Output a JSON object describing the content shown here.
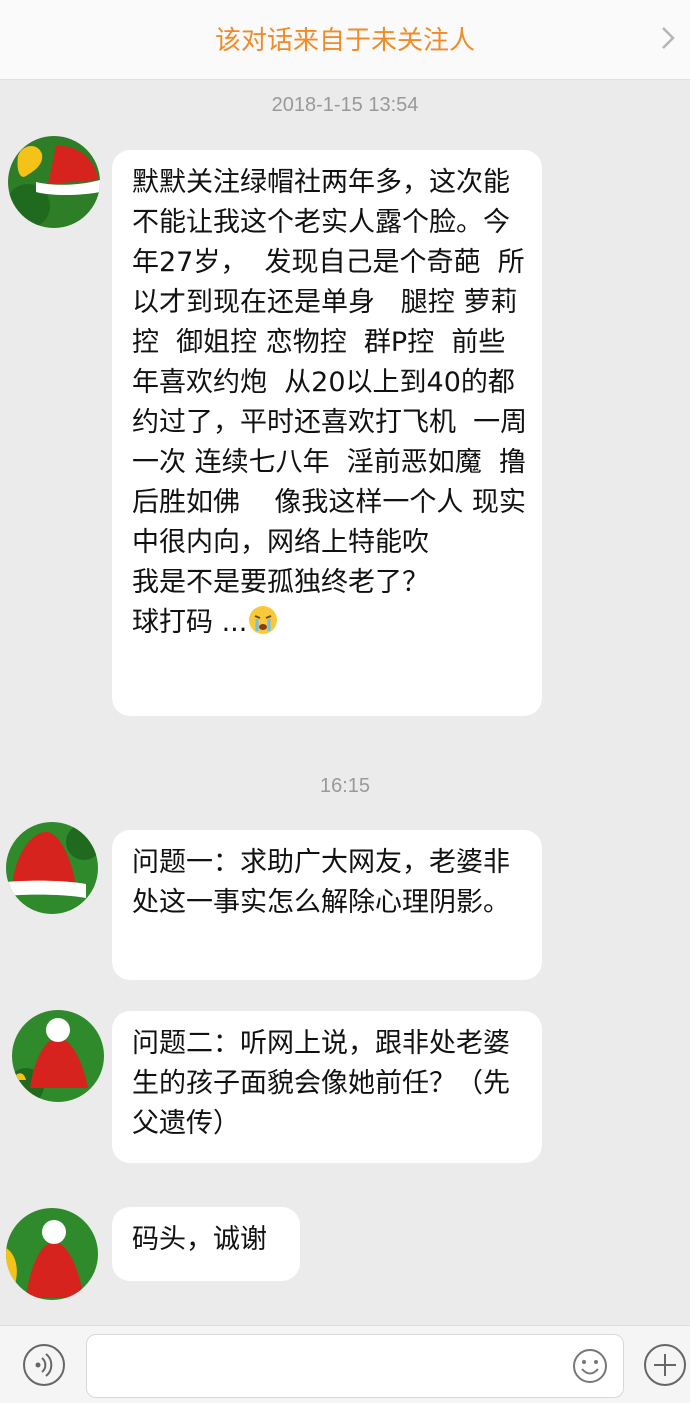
{
  "header": {
    "title": "该对话来自于未关注人"
  },
  "messages": [
    {
      "timestamp": "2018-1-15 13:54",
      "text": "默默关注绿帽社两年多，这次能不能让我这个老实人露个脸。今年27岁，  发现自己是个奇葩  所以才到现在还是单身   腿控 萝莉控  御姐控 恋物控  群P控  前些年喜欢约炮  从20以上到40的都约过了，平时还喜欢打飞机  一周一次 连续七八年  淫前恶如魔  撸后胜如佛    像我这样一个人 现实中很内向，网络上特能吹\n我是不是要孤独终老了？\n球打码 ..."
    },
    {
      "timestamp": "16:15",
      "text": "问题一：求助广大网友，老婆非处这一事实怎么解除心理阴影。"
    },
    {
      "text": "问题二：听网上说，跟非处老婆生的孩子面貌会像她前任？（先父遗传）"
    },
    {
      "text": "码头，诚谢"
    }
  ],
  "icons": {
    "header_chevron": "chevron-right-icon",
    "voice": "voice-icon",
    "emoji": "emoji-icon",
    "plus": "plus-icon",
    "inline_emoji": "crying-face-icon"
  },
  "colors": {
    "header_title": "#f08c28",
    "background": "#ebebeb",
    "bubble": "#ffffff",
    "timestamp": "#999999"
  }
}
